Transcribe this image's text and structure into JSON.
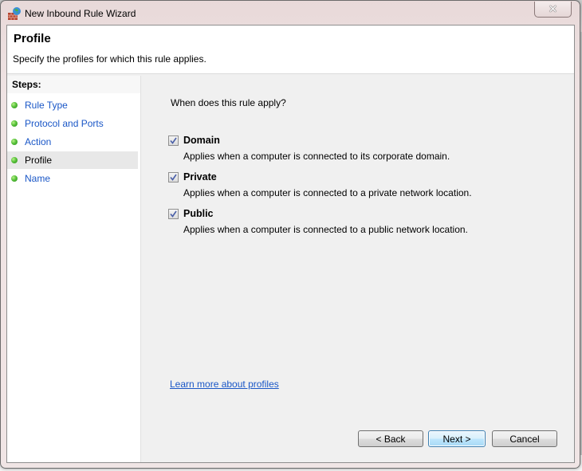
{
  "window": {
    "title": "New Inbound Rule Wizard",
    "close_glyph": "✕"
  },
  "header": {
    "title": "Profile",
    "subtitle": "Specify the profiles for which this rule applies."
  },
  "steps": {
    "heading": "Steps:",
    "items": [
      {
        "label": "Rule Type",
        "active": false
      },
      {
        "label": "Protocol and Ports",
        "active": false
      },
      {
        "label": "Action",
        "active": false
      },
      {
        "label": "Profile",
        "active": true
      },
      {
        "label": "Name",
        "active": false
      }
    ]
  },
  "main": {
    "question": "When does this rule apply?",
    "options": [
      {
        "label": "Domain",
        "description": "Applies when a computer is connected to its corporate domain.",
        "checked": true
      },
      {
        "label": "Private",
        "description": "Applies when a computer is connected to a private network location.",
        "checked": true
      },
      {
        "label": "Public",
        "description": "Applies when a computer is connected to a public network location.",
        "checked": true
      }
    ],
    "learn_more_link": "Learn more about profiles"
  },
  "buttons": {
    "back": "< Back",
    "next": "Next >",
    "cancel": "Cancel"
  },
  "colors": {
    "link": "#1a57c7",
    "step_dot": "#57c23a",
    "default_button": "#bee6fd"
  }
}
